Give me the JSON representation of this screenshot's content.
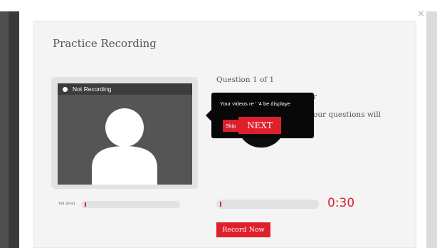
{
  "modal": {
    "title": "Practice Recording",
    "close_label": "×"
  },
  "video": {
    "status_label": "Not Recording"
  },
  "question": {
    "count_label": "Question 1 of 1",
    "partial_fragment": "r",
    "text_fragment": "our questions will"
  },
  "tooltip": {
    "text": "Your videos re ' '4 be displaye",
    "skip_label": "Skip",
    "next_label": "NEXT"
  },
  "controls": {
    "vol_label": "Vol level",
    "vol_level": 0.01,
    "timer_progress": 0.01,
    "timer_value": "0:30",
    "record_label": "Record Now"
  },
  "colors": {
    "accent": "#e01f2d",
    "video_bg": "#555555",
    "tooltip_bg": "#080808",
    "backdrop": "#4f4f4f"
  },
  "icons": {
    "avatar": "user-silhouette-icon",
    "close": "close-icon",
    "status": "record-dot-icon"
  }
}
